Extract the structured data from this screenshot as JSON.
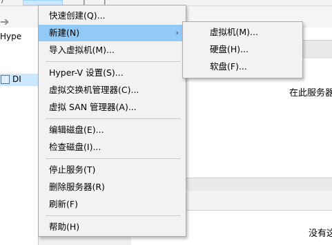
{
  "menubar": {
    "fragments": [
      "/",
      "|",
      "|"
    ]
  },
  "left_pane": {
    "header": "Hype",
    "node_label": "DI"
  },
  "main": {
    "message_1": "在此服务器",
    "message_2": "没有这"
  },
  "context_menu": {
    "items": [
      {
        "label": "快速创建(Q)..."
      },
      {
        "label": "新建(N)",
        "submenu_indicator": "›"
      },
      {
        "label": "导入虚拟机(M)..."
      },
      {
        "label": "Hyper-V 设置(S)..."
      },
      {
        "label": "虚拟交换机管理器(C)..."
      },
      {
        "label": "虚拟 SAN 管理器(A)..."
      },
      {
        "label": "编辑磁盘(E)..."
      },
      {
        "label": "检查磁盘(I)..."
      },
      {
        "label": "停止服务(T)"
      },
      {
        "label": "删除服务器(R)"
      },
      {
        "label": "刷新(F)"
      },
      {
        "label": "帮助(H)"
      }
    ]
  },
  "submenu": {
    "items": [
      {
        "label": "虚拟机(M)..."
      },
      {
        "label": "硬盘(H)..."
      },
      {
        "label": "软盘(F)..."
      }
    ]
  },
  "colors": {
    "highlight": "#91c9f7",
    "selected_node": "#cce8ff"
  }
}
